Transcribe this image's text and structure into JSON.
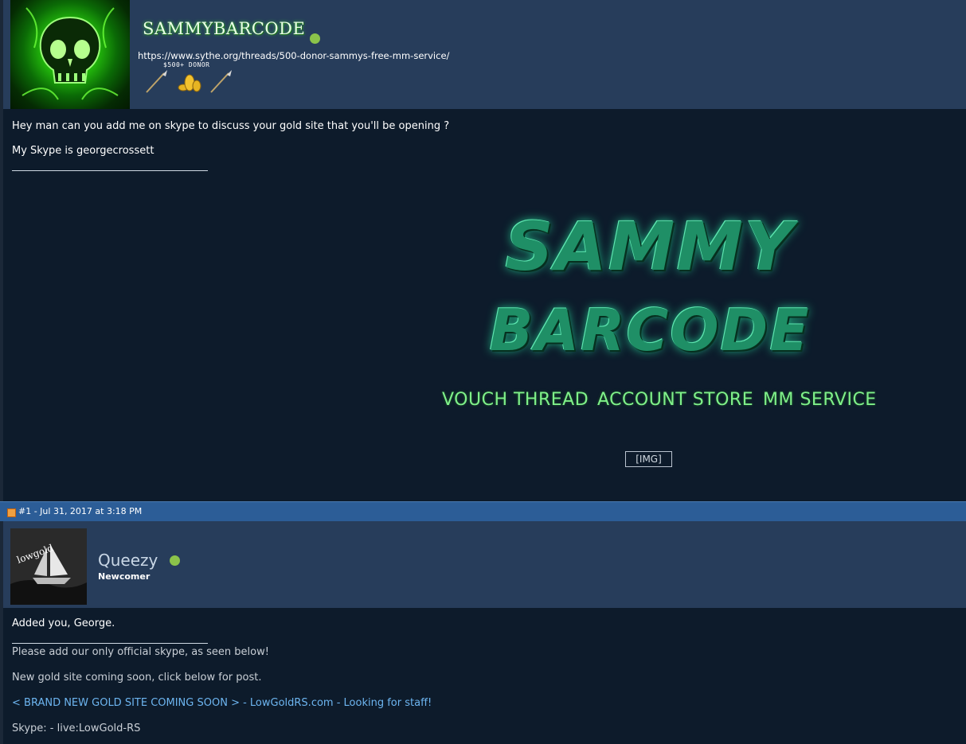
{
  "post1": {
    "username": "SAMMYBARCODE",
    "signature_url": "https://www.sythe.org/threads/500-donor-sammys-free-mm-service/",
    "donor_badge": "$500+ DONOR",
    "message_line1": "Hey man can you add me on skype to discuss your gold site that you'll be opening ?",
    "message_line2": "My Skype is georgecrossett",
    "banner": {
      "line1": "SAMMY",
      "line2": "BARCODE",
      "links": [
        "VOUCH THREAD",
        "ACCOUNT STORE",
        "MM SERVICE"
      ]
    },
    "img_placeholder": "[IMG]"
  },
  "post_meta": {
    "text": "#1 - Jul 31, 2017 at 3:18 PM"
  },
  "post2": {
    "username": "Queezy",
    "rank": "Newcomer",
    "message": "Added you, George.",
    "sig_line1": "Please add our only official skype, as seen below!",
    "sig_line2": "New gold site coming soon, click below for post.",
    "sig_link": "< BRAND NEW GOLD SITE COMING SOON > - LowGoldRS.com - Looking for staff!",
    "sig_skype": "Skype: - live:LowGold-RS",
    "avatar_text": "lowgold"
  },
  "colors": {
    "header_bg": "#273d5b",
    "body_bg": "#0d1b2b",
    "meta_bar": "#2c5d97",
    "online": "#8bc34a",
    "link": "#6db5f0",
    "banner_green": "#7ff08a"
  },
  "icons": [
    "skull-avatar",
    "online-dot-icon",
    "dragon-spear-icon",
    "gold-coins-icon",
    "post-icon"
  ]
}
